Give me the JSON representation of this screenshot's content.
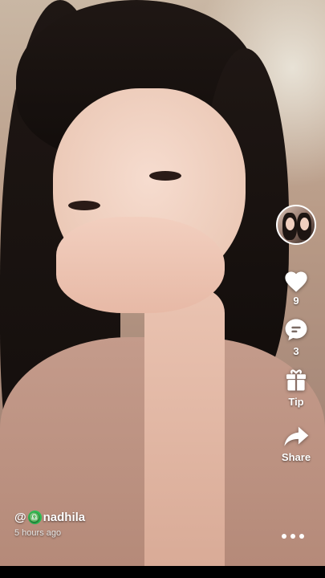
{
  "video": {
    "description_icon": "video-frame"
  },
  "author": {
    "at_sign": "@",
    "badge_symbol": "♎",
    "name": "nadhila",
    "posted": "5 hours ago"
  },
  "actions": {
    "like_count": "9",
    "comment_count": "3",
    "tip_label": "Tip",
    "share_label": "Share"
  },
  "colors": {
    "badge": "#2fbf55",
    "icon": "#ffffff"
  }
}
